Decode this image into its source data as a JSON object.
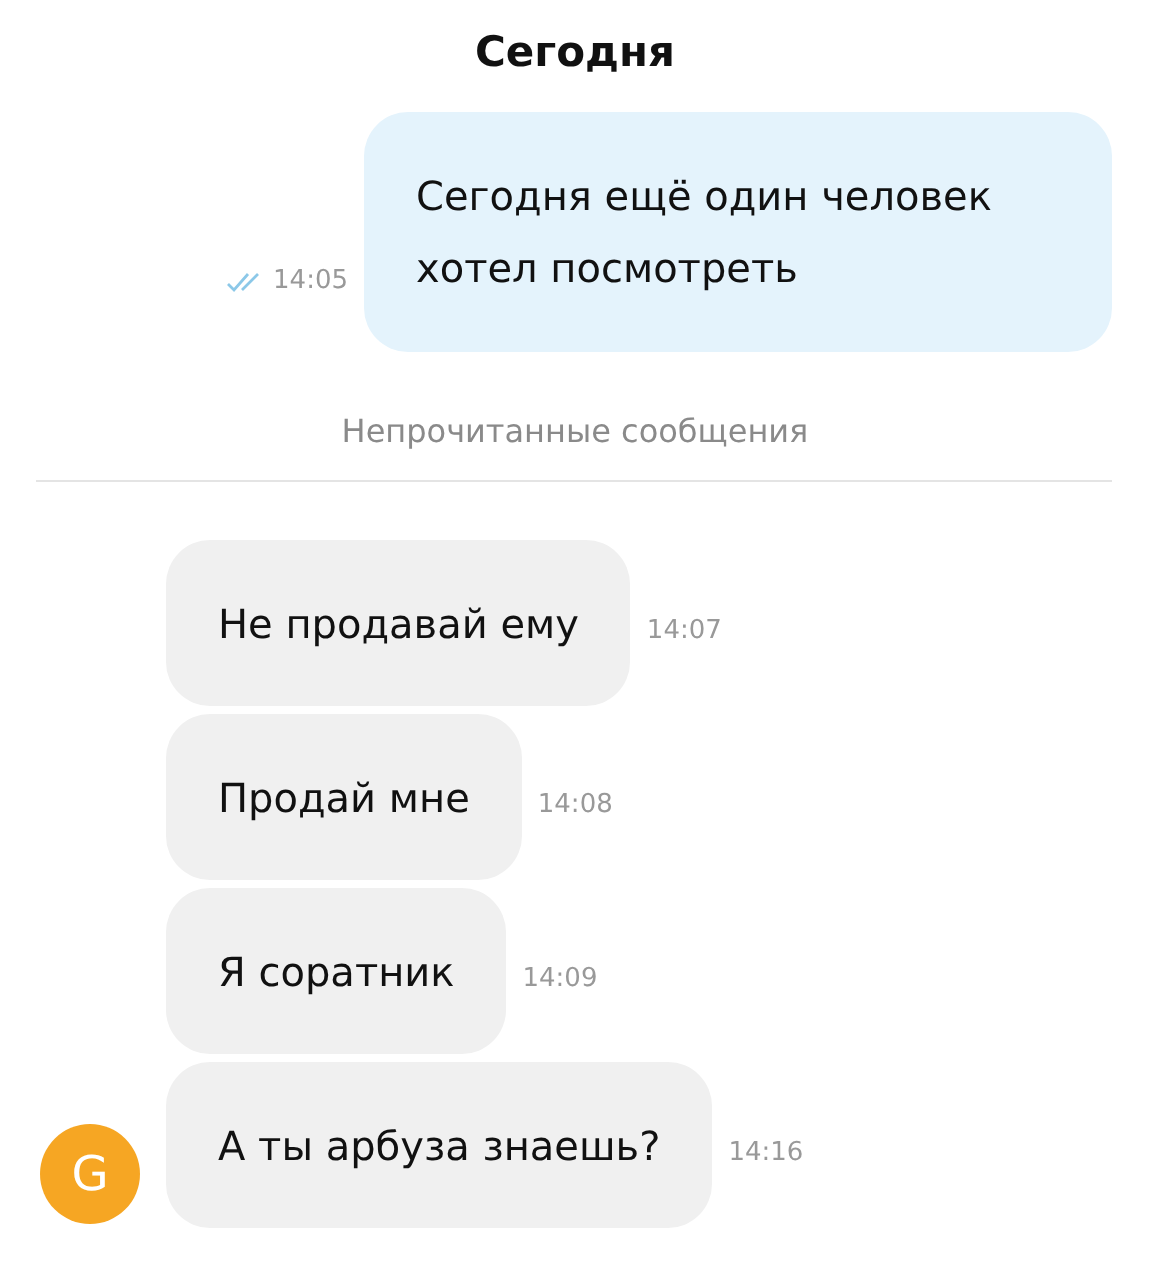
{
  "date_header": "Сегодня",
  "outgoing": [
    {
      "text": "Сегодня ещё один человек хотел посмотреть",
      "time": "14:05",
      "read": true
    }
  ],
  "unread_divider": "Непрочитанные сообщения",
  "incoming": [
    {
      "text": "Не продавай ему",
      "time": "14:07"
    },
    {
      "text": "Продай мне",
      "time": "14:08"
    },
    {
      "text": "Я соратник",
      "time": "14:09"
    },
    {
      "text": "А ты арбуза знаешь?",
      "time": "14:16",
      "avatar": {
        "letter": "G",
        "color": "#f6a623"
      }
    }
  ]
}
